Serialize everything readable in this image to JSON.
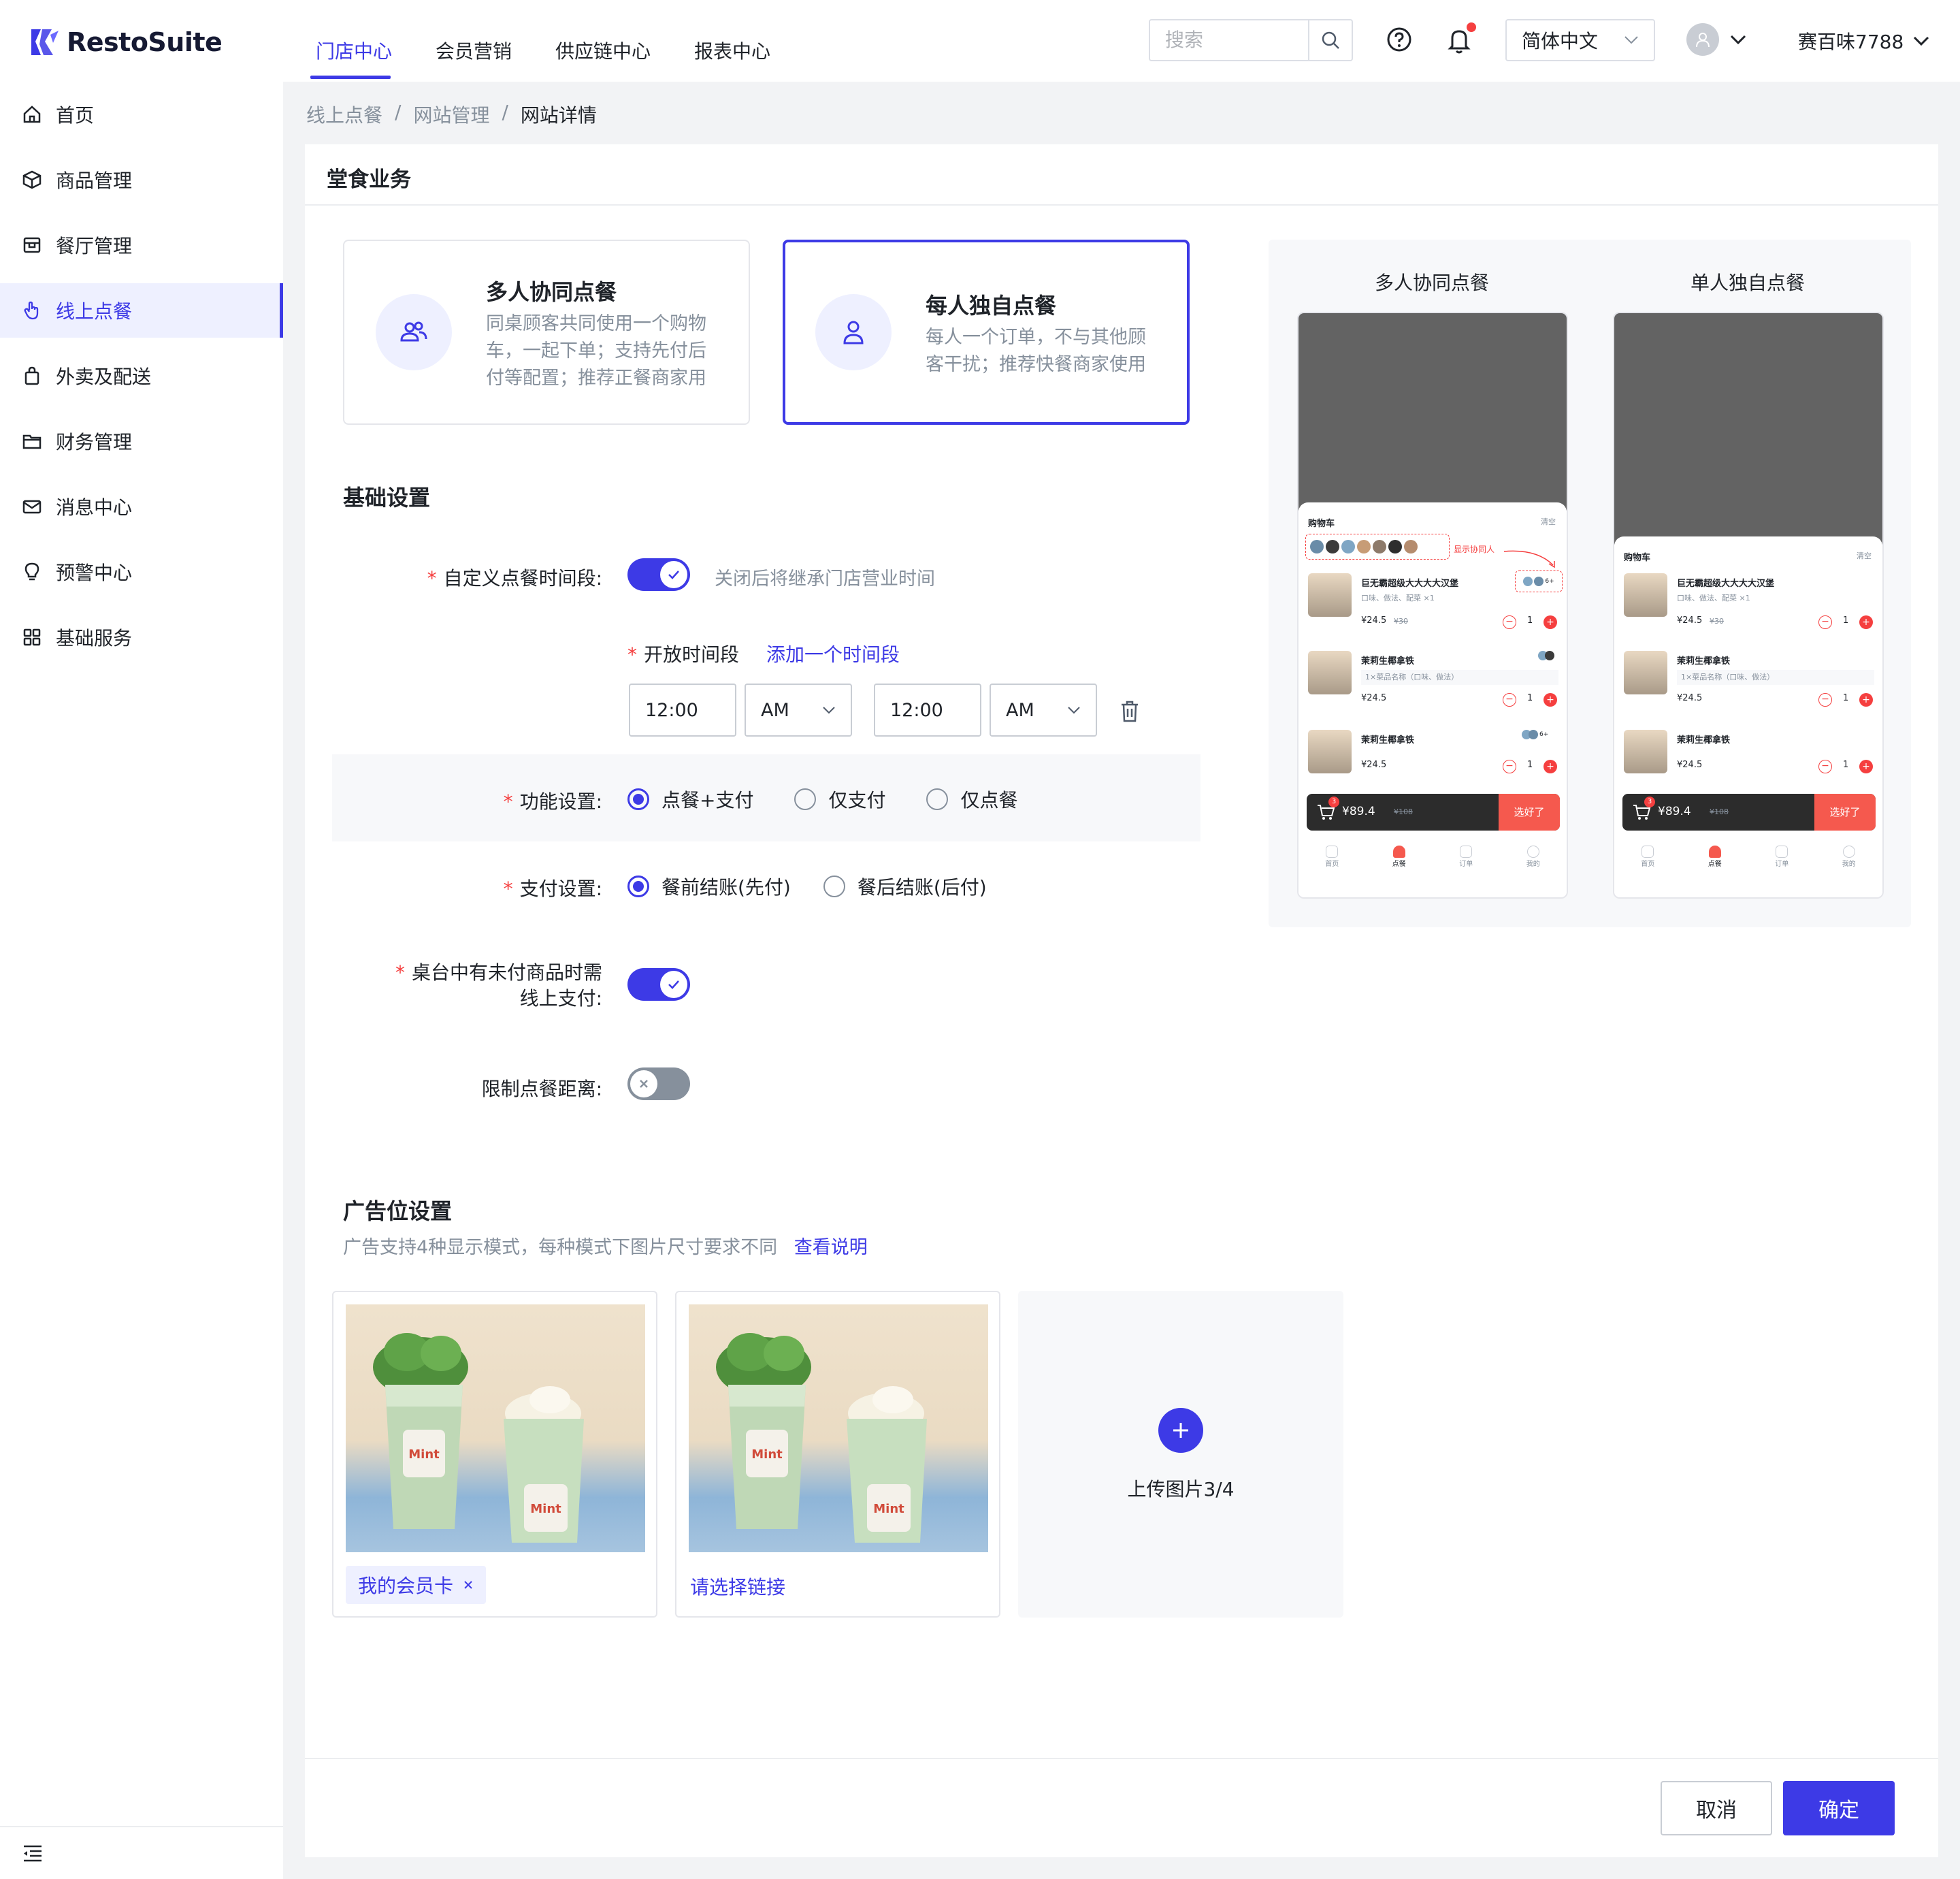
{
  "app": {
    "name": "RestoSuite"
  },
  "nav": {
    "tabs": [
      "门店中心",
      "会员营销",
      "供应链中心",
      "报表中心"
    ],
    "active": "门店中心"
  },
  "header": {
    "search_placeholder": "搜索",
    "language": "简体中文",
    "user_name": "赛百味7788"
  },
  "sidebar": {
    "items": [
      {
        "label": "首页",
        "icon": "home-icon"
      },
      {
        "label": "商品管理",
        "icon": "box-icon"
      },
      {
        "label": "餐厅管理",
        "icon": "store-icon"
      },
      {
        "label": "线上点餐",
        "icon": "hand-pointer-icon",
        "active": true
      },
      {
        "label": "外卖及配送",
        "icon": "bag-icon"
      },
      {
        "label": "财务管理",
        "icon": "folder-icon"
      },
      {
        "label": "消息中心",
        "icon": "mail-icon"
      },
      {
        "label": "预警中心",
        "icon": "bulb-icon"
      },
      {
        "label": "基础服务",
        "icon": "grid-icon"
      }
    ]
  },
  "breadcrumb": [
    "线上点餐",
    "网站管理",
    "网站详情"
  ],
  "section_title": "堂食业务",
  "modes": [
    {
      "title": "多人协同点餐",
      "desc": "同桌顾客共同使用一个购物车，一起下单；支持先付后付等配置；推荐正餐商家用",
      "selected": false
    },
    {
      "title": "每人独自点餐",
      "desc": "每人一个订单，不与其他顾客干扰；推荐快餐商家使用",
      "selected": true
    }
  ],
  "basic": {
    "title": "基础设置",
    "custom_time_label": "自定义点餐时间段:",
    "custom_time_on": true,
    "custom_time_hint": "关闭后将继承门店营业时间",
    "open_time_label": "开放时间段",
    "add_time_link": "添加一个时间段",
    "start_time": "12:00",
    "start_ampm": "AM",
    "end_time": "12:00",
    "end_ampm": "AM",
    "function_label": "功能设置:",
    "function_options": [
      "点餐+支付",
      "仅支付",
      "仅点餐"
    ],
    "function_selected": "点餐+支付",
    "payment_label": "支付设置:",
    "payment_options": [
      "餐前结账(先付)",
      "餐后结账(后付)"
    ],
    "payment_selected": "餐前结账(先付)",
    "unpaid_label_1": "桌台中有未付商品时需",
    "unpaid_label_2": "线上支付:",
    "unpaid_on": true,
    "distance_label": "限制点餐距离:",
    "distance_on": false
  },
  "preview": {
    "titles": [
      "多人协同点餐",
      "单人独自点餐"
    ],
    "cart_title": "购物车",
    "clear": "清空",
    "show_collab": "显示协同人",
    "items": [
      {
        "name": "巨无霸超级大大大大汉堡",
        "opts": "口味、做法、配菜 ×1",
        "price": "¥24.5",
        "orig": "¥30",
        "qty": "1"
      },
      {
        "name": "茉莉生椰拿铁",
        "opts": "1×菜品名称（口味、做法）",
        "price": "¥24.5",
        "qty": "1"
      },
      {
        "name": "茉莉生椰拿铁",
        "price": "¥24.5",
        "qty": "1"
      }
    ],
    "badge_more": "6+",
    "cart_badge": "3",
    "total": "¥89.4",
    "total_orig": "¥108",
    "done": "选好了",
    "tabs": [
      "首页",
      "点餐",
      "订单",
      "我的"
    ]
  },
  "ads": {
    "title": "广告位设置",
    "desc": "广告支持4种显示模式，每种模式下图片尺寸要求不同",
    "desc_link": "查看说明",
    "cards": [
      {
        "tag": "我的会员卡",
        "cup_text": "Mint"
      },
      {
        "link": "请选择链接",
        "cup_text": "Mint"
      }
    ],
    "upload_label": "上传图片3/4"
  },
  "footer": {
    "cancel": "取消",
    "ok": "确定"
  },
  "colors": {
    "accent": "#3d3ae6",
    "danger": "#f53f3f"
  }
}
